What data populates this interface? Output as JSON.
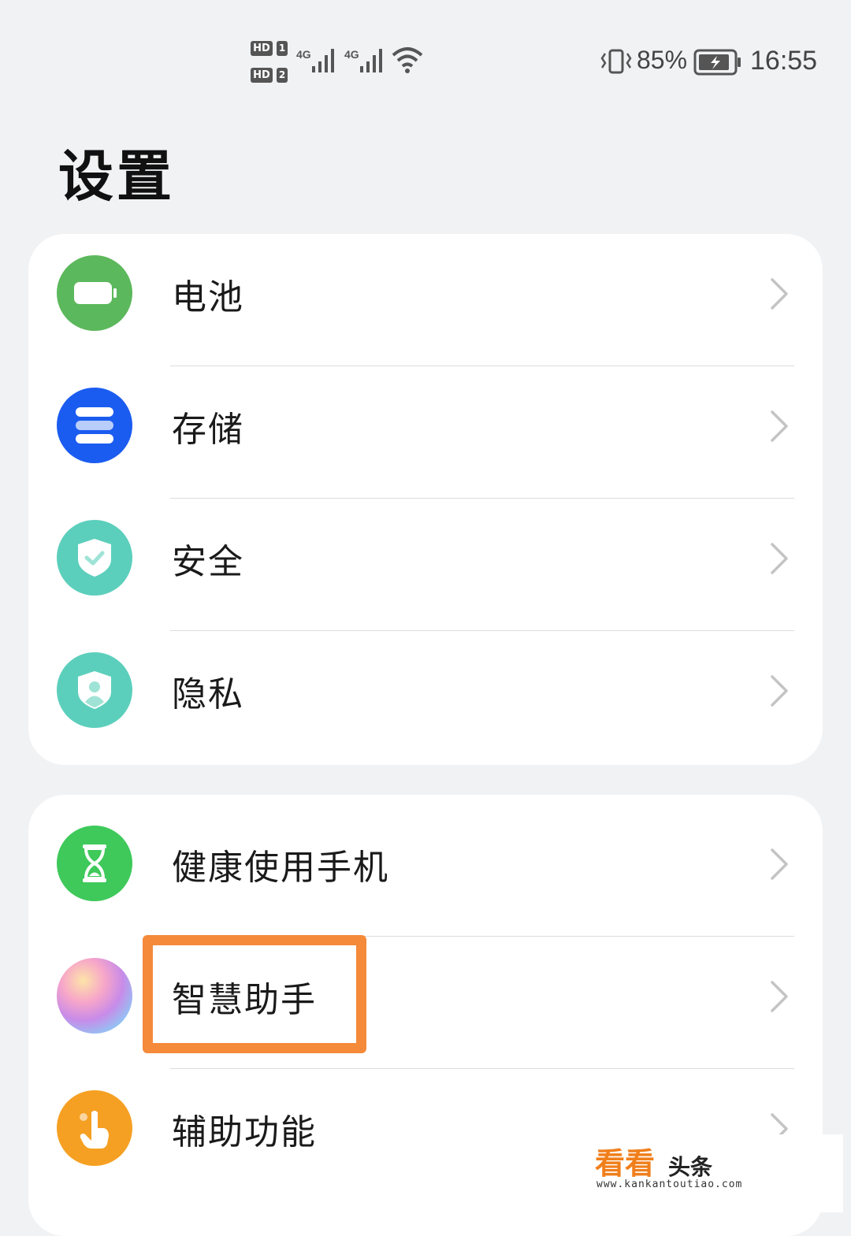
{
  "status_bar": {
    "sim1_hd": "HD",
    "sim1_num": "1",
    "sim2_hd": "HD",
    "sim2_num": "2",
    "net1": "4G",
    "net2": "4G",
    "battery_percent": "85%",
    "time": "16:55"
  },
  "page_title": "设置",
  "groups": [
    {
      "items": [
        {
          "label": "电池",
          "icon": "battery-icon",
          "color": "#5cb85c"
        },
        {
          "label": "存储",
          "icon": "storage-icon",
          "color": "#1b5cf0"
        },
        {
          "label": "安全",
          "icon": "shield-check-icon",
          "color": "#5ccfbc"
        },
        {
          "label": "隐私",
          "icon": "privacy-shield-icon",
          "color": "#5ccfbc"
        }
      ]
    },
    {
      "items": [
        {
          "label": "健康使用手机",
          "icon": "hourglass-icon",
          "color": "#3ec95a"
        },
        {
          "label": "智慧助手",
          "icon": "assistant-orb-icon",
          "color": "#c88be8"
        },
        {
          "label": "辅助功能",
          "icon": "touch-hand-icon",
          "color": "#f5a023"
        }
      ]
    }
  ],
  "highlight_color": "#f58a3a",
  "watermark": {
    "brand": "看看",
    "brand2": "头条",
    "url": "www.kankantoutiao.com"
  }
}
